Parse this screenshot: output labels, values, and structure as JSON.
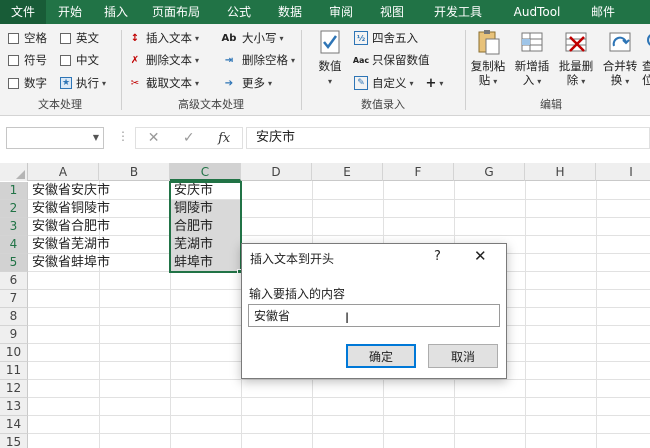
{
  "tabs": [
    "文件",
    "开始",
    "插入",
    "页面布局",
    "公式",
    "数据",
    "审阅",
    "视图",
    "开发工具",
    "AudTool",
    "邮件"
  ],
  "ribbon": {
    "text_group": {
      "label": "文本处理",
      "checks": [
        "空格",
        "英文",
        "符号",
        "中文",
        "数字",
        "执行"
      ]
    },
    "adv_group": {
      "label": "高级文本处理",
      "items": [
        "插入文本",
        "删除文本",
        "截取文本",
        "大小写",
        "删除空格",
        "更多"
      ]
    },
    "num_group": {
      "label": "数值录入",
      "value_btn": "数值",
      "items": [
        "四舍五入",
        "只保留数值",
        "自定义"
      ]
    },
    "edit_group": {
      "label": "编辑",
      "buttons": [
        {
          "line1": "复制粘",
          "line2": "贴"
        },
        {
          "line1": "新增插",
          "line2": "入"
        },
        {
          "line1": "批量删",
          "line2": "除"
        },
        {
          "line1": "合并转",
          "line2": "换"
        },
        {
          "line1": "查找",
          "line2": "位"
        }
      ]
    }
  },
  "formula_bar": {
    "name_box": "",
    "fx": "fx",
    "cancel": "✕",
    "confirm": "✓",
    "value": "安庆市"
  },
  "grid": {
    "columns": [
      "A",
      "B",
      "C",
      "D",
      "E",
      "F",
      "G",
      "H",
      "I"
    ],
    "selected_column": "C",
    "rows": [
      "1",
      "2",
      "3",
      "4",
      "5",
      "6",
      "7",
      "8",
      "9",
      "10",
      "11",
      "12",
      "13",
      "14",
      "15"
    ],
    "col_a": [
      "安徽省安庆市",
      "安徽省铜陵市",
      "安徽省合肥市",
      "安徽省芜湖市",
      "安徽省蚌埠市"
    ],
    "col_c": [
      "安庆市",
      "铜陵市",
      "合肥市",
      "芜湖市",
      "蚌埠市"
    ]
  },
  "dialog": {
    "title": "插入文本到开头",
    "help": "?",
    "close": "✕",
    "prompt": "输入要插入的内容",
    "input_value": "安徽省",
    "ok": "确定",
    "cancel": "取消"
  }
}
